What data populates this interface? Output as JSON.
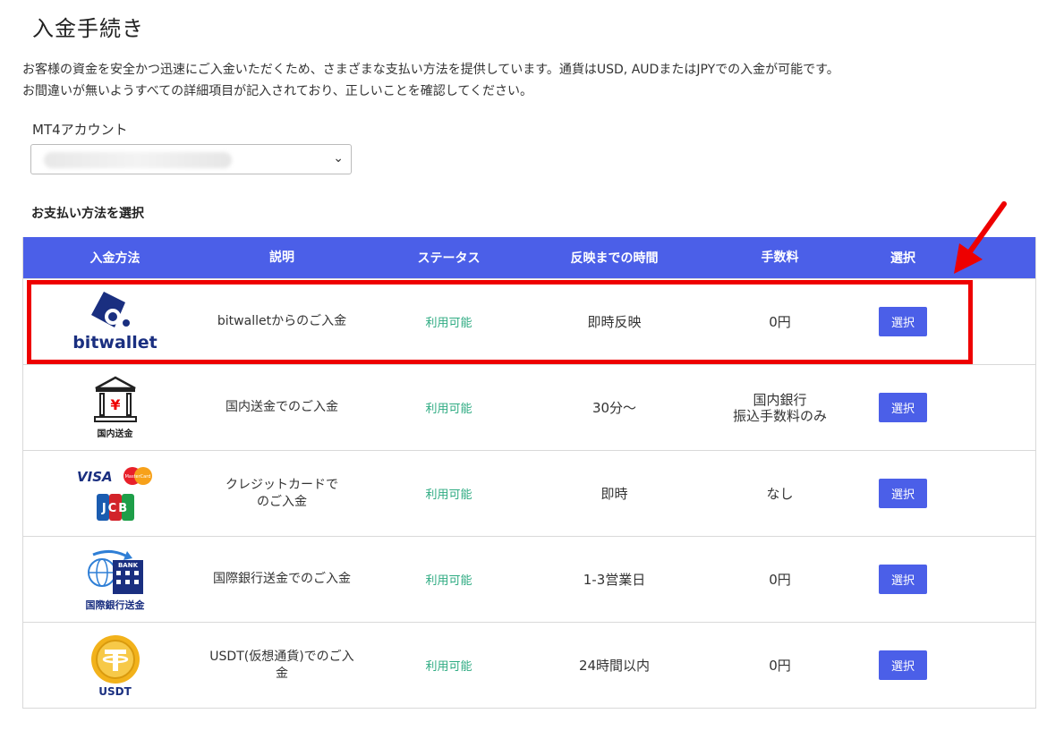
{
  "page": {
    "title": "入金手続き",
    "description_line1": "お客様の資金を安全かつ迅速にご入金いただくため、さまざまな支払い方法を提供しています。通貨はUSD, AUDまたはJPYでの入金が可能です。",
    "description_line2": "お間違いが無いようすべての詳細項目が記入されており、正しいことを確認してください。"
  },
  "account": {
    "label": "MT4アカウント"
  },
  "payment": {
    "section_title": "お支払い方法を選択",
    "headers": [
      "入金方法",
      "説明",
      "ステータス",
      "反映までの時間",
      "手数料",
      "選択"
    ],
    "rows": [
      {
        "logo": "bitwallet-logo",
        "logo_text": "bitwallet",
        "description": "bitwalletからのご入金",
        "status": "利用可能",
        "time": "即時反映",
        "fee": "0円",
        "fee2": "",
        "button": "選択"
      },
      {
        "logo": "domestic-bank-icon",
        "logo_text": "国内送金",
        "description": "国内送金でのご入金",
        "status": "利用可能",
        "time": "30分～",
        "fee": "国内銀行",
        "fee2": "振込手数料のみ",
        "button": "選択"
      },
      {
        "logo": "credit-card-logos",
        "logo_text": "",
        "description": "クレジットカードでのご入金",
        "status": "利用可能",
        "time": "即時",
        "fee": "なし",
        "fee2": "",
        "button": "選択"
      },
      {
        "logo": "international-bank-icon",
        "logo_text": "国際銀行送金",
        "description": "国際銀行送金でのご入金",
        "status": "利用可能",
        "time": "1-3営業日",
        "fee": "0円",
        "fee2": "",
        "button": "選択"
      },
      {
        "logo": "usdt-coin-icon",
        "logo_text": "USDT",
        "description": "USDT(仮想通貨)でのご入金",
        "status": "利用可能",
        "time": "24時間以内",
        "fee": "0円",
        "fee2": "",
        "button": "選択"
      }
    ],
    "card_brands": {
      "visa": "VISA",
      "mastercard": "MasterCard",
      "jcb": "JCB",
      "bank": "BANK",
      "yen": "¥"
    }
  },
  "colors": {
    "header_bg": "#4b5fe8",
    "button_bg": "#4b5fe8",
    "status_green": "#2eab82",
    "highlight_red": "#ee0000",
    "brand_navy": "#1a2f80"
  }
}
